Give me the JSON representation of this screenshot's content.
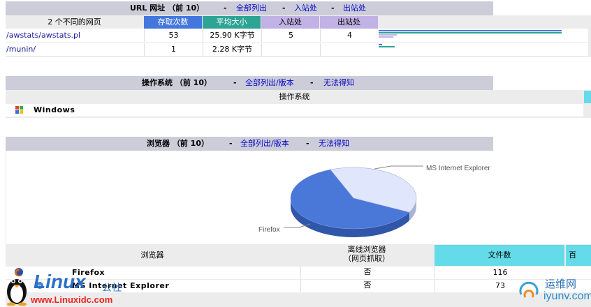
{
  "url_section": {
    "title": "URL 网址 （前 10）",
    "links": [
      "全部列出",
      "入站处",
      "出站处"
    ],
    "headers": [
      "2 个不同的网页",
      "存取次数",
      "平均大小",
      "入站处",
      "出站处"
    ],
    "rows": [
      {
        "url": "/awstats/awstats.pl",
        "hits": "53",
        "size": "25.90 K字节",
        "entry": "5",
        "exit": "4",
        "bars": {
          "hits": 1.0,
          "size": 1.0,
          "entry": 0.1,
          "exit": 0.08
        }
      },
      {
        "url": "/munin/",
        "hits": "1",
        "size": "2.28 K字节",
        "entry": "",
        "exit": "",
        "bars": {
          "hits": 0.02,
          "size": 0.088,
          "entry": 0.0,
          "exit": 0.0
        }
      }
    ],
    "colors": {
      "hits": "#4477dd",
      "size": "#2ea495",
      "entry": "#c1b2e5",
      "exit": "#c1b2e5"
    }
  },
  "os_section": {
    "title": "操作系统 （前 10）",
    "links": [
      "全部列出/版本",
      "无法得知"
    ],
    "header": "操作系统",
    "rows": [
      {
        "name": "Windows",
        "icon": "windows-icon"
      }
    ]
  },
  "browser_section": {
    "title": "浏览器 （前 10）",
    "links": [
      "全部列出/版本",
      "无法得知"
    ],
    "chart_data": {
      "type": "pie",
      "labels": [
        "MS Internet Explorer",
        "Firefox"
      ],
      "values": [
        73,
        116
      ],
      "colors": [
        "#e0e6fb",
        "#4a78d8"
      ]
    },
    "headers": [
      "浏览器",
      "离线浏览器\n（网页抓取）",
      "文件数",
      "百"
    ],
    "rows": [
      {
        "name": "Firefox",
        "offline": "否",
        "files": "116",
        "icon": "firefox-icon"
      },
      {
        "name": "MS Internet Explorer",
        "offline": "否",
        "files": "73",
        "icon": "ie-icon"
      }
    ]
  },
  "watermarks": {
    "left_brand": "Linux",
    "left_brand_suffix": "公社",
    "left_url": "www.Linuxidc.com",
    "right_brand": "运维网",
    "right_url": "iyunv.com"
  }
}
